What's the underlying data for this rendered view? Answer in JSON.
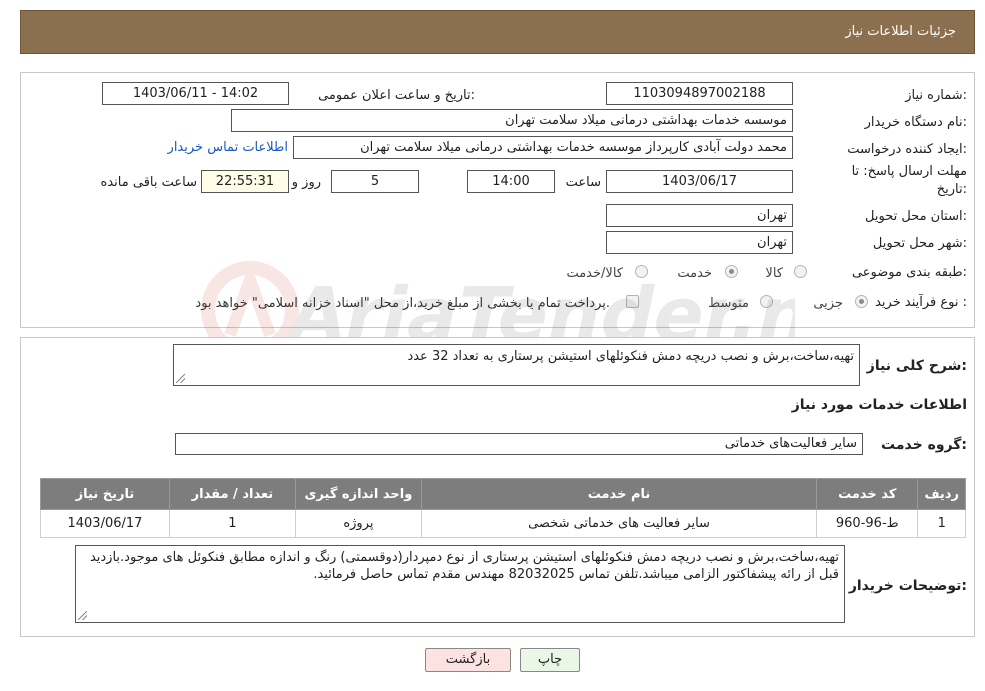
{
  "header": {
    "title": "جزئیات اطلاعات نیاز"
  },
  "form": {
    "need_number_label": "شماره نیاز:",
    "need_number": "1103094897002188",
    "announce_label": "تاریخ و ساعت اعلان عمومی:",
    "announce_value": "1403/06/11 - 14:02",
    "buyer_org_label": "نام دستگاه خریدار:",
    "buyer_org": "موسسه خدمات بهداشتی درمانی میلاد سلامت تهران",
    "requester_label": "ایجاد کننده درخواست:",
    "requester": "محمد دولت آبادی کارپرداز موسسه خدمات بهداشتی درمانی میلاد سلامت تهران",
    "contact_link": "اطلاعات تماس خریدار",
    "deadline_label_1": "مهلت ارسال پاسخ: تا",
    "deadline_label_2": "تاریخ:",
    "deadline_date": "1403/06/17",
    "time_label": "ساعت",
    "deadline_time": "14:00",
    "days_value": "5",
    "days_label": "روز و",
    "remaining_value": "22:55:31",
    "remaining_label": "ساعت باقی مانده",
    "province_label": "استان محل تحویل:",
    "province": "تهران",
    "city_label": "شهر محل تحویل:",
    "city": "تهران",
    "category_label": "طبقه بندی موضوعی:",
    "category_options": [
      "کالا",
      "خدمت",
      "کالا/خدمت"
    ],
    "process_label": "نوع فرآیند خرید :",
    "process_options": [
      "جزیی",
      "متوسط"
    ],
    "payment_note": "پرداخت تمام یا بخشی از مبلغ خرید،از محل \"اسناد خزانه اسلامی\" خواهد بود."
  },
  "summary": {
    "label": "شرح کلی نیاز:",
    "text": "تهیه،ساخت،برش و نصب دریچه دمش فنکوئلهای استیشن پرستاری به تعداد 32 عدد"
  },
  "services": {
    "section_title": "اطلاعات خدمات مورد نیاز",
    "group_label": "گروه خدمت:",
    "group_value": "سایر فعالیت‌های خدماتی",
    "columns": [
      "ردیف",
      "کد خدمت",
      "نام خدمت",
      "واحد اندازه گیری",
      "تعداد / مقدار",
      "تاریخ نیاز"
    ],
    "rows": [
      [
        "1",
        "ط-96-960",
        "سایر فعالیت های خدماتی شخصی",
        "پروژه",
        "1",
        "1403/06/17"
      ]
    ]
  },
  "buyer_notes": {
    "label": "توضیحات خریدار:",
    "text": "تهیه،ساخت،برش و نصب دریچه دمش فنکوئلهای استیشن پرستاری از نوع دمپردار(دوقسمتی) رنگ و اندازه مطابق فنکوئل های موجود.بازدید قبل از رائه پیشفاکتور الزامی میباشد.تلفن تماس 82032025 مهندس مقدم تماس حاصل فرمائید."
  },
  "buttons": {
    "print": "چاپ",
    "back": "بازگشت"
  },
  "watermark": "AriaTender.neT"
}
